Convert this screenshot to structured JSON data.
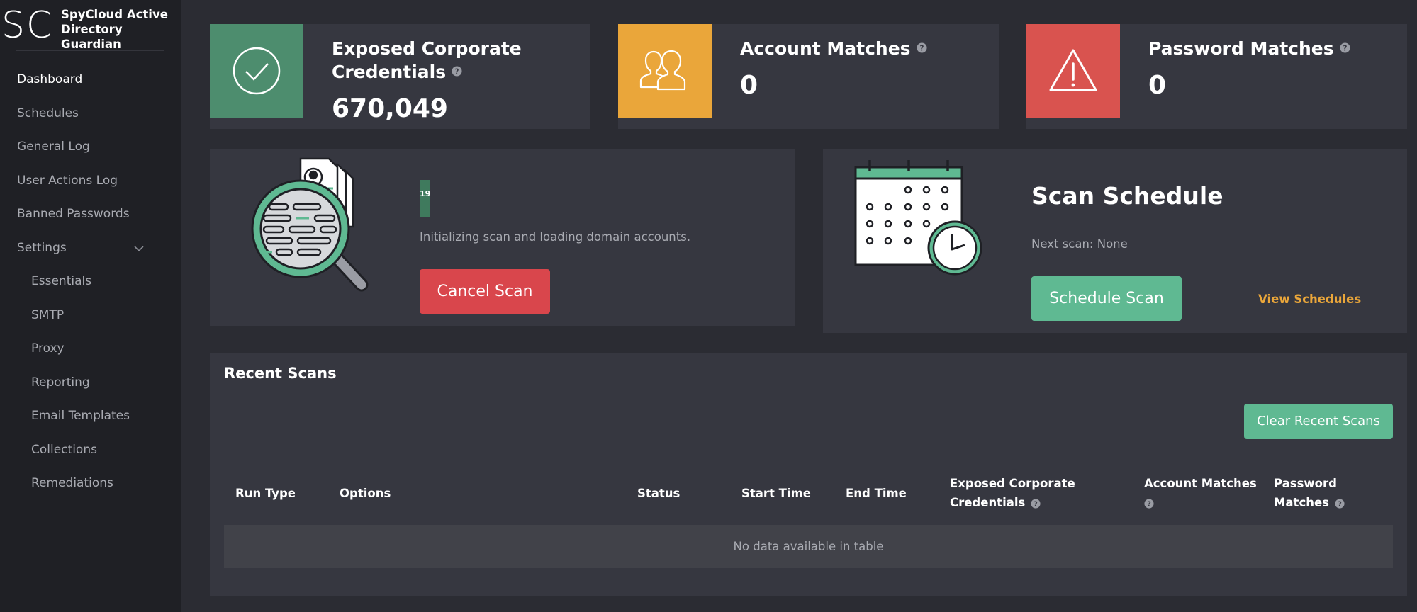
{
  "app": {
    "logo_mark": "SC",
    "title": "SpyCloud Active Directory Guardian"
  },
  "sidebar": {
    "items": [
      {
        "label": "Dashboard",
        "active": true
      },
      {
        "label": "Schedules"
      },
      {
        "label": "General Log"
      },
      {
        "label": "User Actions Log"
      },
      {
        "label": "Banned Passwords"
      },
      {
        "label": "Settings",
        "expanded": true
      },
      {
        "label": "Essentials",
        "sub": true
      },
      {
        "label": "SMTP",
        "sub": true
      },
      {
        "label": "Proxy",
        "sub": true
      },
      {
        "label": "Reporting",
        "sub": true
      },
      {
        "label": "Email Templates",
        "sub": true
      },
      {
        "label": "Collections",
        "sub": true
      },
      {
        "label": "Remediations",
        "sub": true
      }
    ]
  },
  "stats": {
    "exposed": {
      "title_line1": "Exposed Corporate",
      "title_line2": "Credentials",
      "value": "670,049",
      "color": "#4d8d6e",
      "icon": "check-circle-icon"
    },
    "accounts": {
      "title": "Account Matches",
      "value": "0",
      "color": "#eaa63a",
      "icon": "users-icon"
    },
    "passwords": {
      "title": "Password Matches",
      "value": "0",
      "color": "#d9534f",
      "icon": "warning-icon"
    }
  },
  "scan": {
    "progress_label": "19",
    "progress_value": 0.01,
    "status_text": "Initializing scan and loading domain accounts.",
    "cancel_label": "Cancel Scan",
    "illustration": "magnifier-document-icon"
  },
  "schedule": {
    "title": "Scan Schedule",
    "next_scan": "Next scan: None",
    "schedule_button": "Schedule Scan",
    "view_link": "View Schedules",
    "link_color": "#eaa63a",
    "illustration": "calendar-clock-icon"
  },
  "recent": {
    "title": "Recent Scans",
    "clear_button": "Clear Recent Scans",
    "columns": {
      "run_type": "Run Type",
      "options": "Options",
      "status": "Status",
      "start_time": "Start Time",
      "end_time": "End Time",
      "exposed_line1": "Exposed Corporate",
      "exposed_line2": "Credentials",
      "accounts": "Account Matches",
      "password_line1": "Password",
      "password_line2": "Matches"
    },
    "empty_text": "No data available in table"
  },
  "colors": {
    "accent_green": "#5fb992",
    "danger_red": "#d9464c",
    "warning_orange": "#eaa63a"
  }
}
